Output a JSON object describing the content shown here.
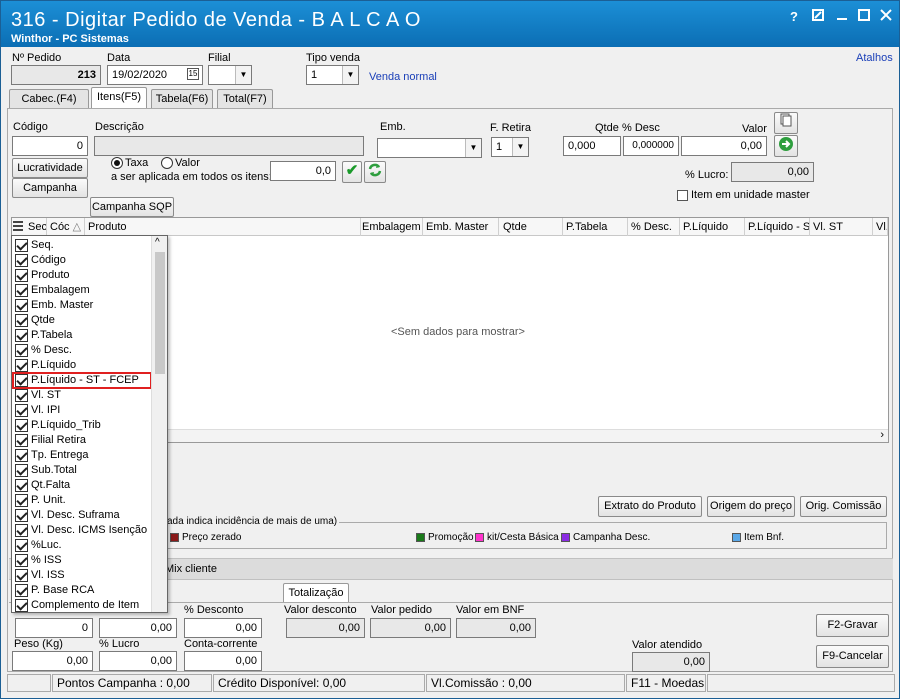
{
  "window": {
    "title": "316 - Digitar Pedido de Venda - B A L C A O",
    "subtitle": "Winthor - PC Sistemas",
    "help_label": "?",
    "atalhos": "Atalhos"
  },
  "header": {
    "pedido_label": "Nº Pedido",
    "pedido_value": "213",
    "data_label": "Data",
    "data_value": "19/02/2020",
    "filial_label": "Filial",
    "filial_value": "",
    "tipo_venda_label": "Tipo venda",
    "tipo_venda_value": "1",
    "venda_normal": "Venda normal"
  },
  "tabs": [
    {
      "label": "Cabec.(F4)"
    },
    {
      "label": "Itens(F5)"
    },
    {
      "label": "Tabela(F6)"
    },
    {
      "label": "Total(F7)"
    }
  ],
  "item_form": {
    "codigo_label": "Código",
    "codigo_value": "0",
    "descricao_label": "Descrição",
    "emb_label": "Emb.",
    "f_retira_label": "F. Retira",
    "f_retira_value": "1",
    "qtde_label": "Qtde",
    "qtde_value": "0,000",
    "pct_desc_label": "% Desc",
    "pct_desc_value": "0,000000",
    "valor_label": "Valor",
    "valor_value": "0,00",
    "lucratividade": "Lucratividade",
    "campanha": "Campanha",
    "taxa_label": "Taxa",
    "valor_radio_label": "Valor",
    "aplicada_label": "a ser aplicada em todos os itens:",
    "aplicada_value": "0,0",
    "pct_lucro_label": "% Lucro:",
    "pct_lucro_value": "0,00",
    "item_master_label": "Item em unidade master",
    "campanha_sqp": "Campanha SQP"
  },
  "grid": {
    "columns": [
      "Sec",
      "Cóc",
      "Produto",
      "Embalagem",
      "Emb. Master",
      "Qtde",
      "P.Tabela",
      "% Desc.",
      "P.Líquido",
      "P.Líquido - S",
      "Vl. ST",
      "Vl."
    ],
    "empty_text": "<Sem dados para mostrar>"
  },
  "column_menu": {
    "items": [
      "Seq.",
      "Código",
      "Produto",
      "Embalagem",
      "Emb. Master",
      "Qtde",
      "P.Tabela",
      "% Desc.",
      "P.Líquido",
      "P.Líquido -  ST - FCEP",
      "Vl. ST",
      "Vl. IPI",
      "P.Líquido_Trib",
      "Filial Retira",
      "Tp. Entrega",
      "Sub.Total",
      "Qt.Falta",
      "P. Unit.",
      "Vl. Desc. Suframa",
      "Vl. Desc. ICMS Isenção",
      "%Luc.",
      "% ISS",
      "Vl. ISS",
      "P. Base RCA",
      "Complemento de Item"
    ],
    "highlighted_index": 9
  },
  "actions": {
    "extrato": "Extrato do Produto",
    "origem": "Origem do preço",
    "comissao": "Orig. Comissão"
  },
  "legend": {
    "caption": "ada indica incidência de mais de uma)",
    "items": [
      {
        "label": "Preço zerado",
        "color": "#8b1a1a"
      },
      {
        "label": "Promoção",
        "color": "#1a7a1a"
      },
      {
        "label": "kit/Cesta Básica",
        "color": "#ff33cc"
      },
      {
        "label": "Campanha Desc.",
        "color": "#8a2be2"
      },
      {
        "label": "Item Bnf.",
        "color": "#5aa8e8"
      }
    ]
  },
  "mix_cliente": "Mix cliente",
  "totalizacao": {
    "tab_label": "Totalização",
    "left_value_1": "0",
    "left_value_2": "0,00",
    "pct_desconto_label": "% Desconto",
    "pct_desconto_value": "0,00",
    "valor_desconto_label": "Valor desconto",
    "valor_desconto_value": "0,00",
    "valor_pedido_label": "Valor pedido",
    "valor_pedido_value": "0,00",
    "valor_bnf_label": "Valor em BNF",
    "valor_bnf_value": "0,00",
    "peso_label": "Peso (Kg)",
    "peso_value": "0,00",
    "pct_lucro_label": "% Lucro",
    "pct_lucro_value": "0,00",
    "conta_label": "Conta-corrente",
    "conta_value": "0,00",
    "valor_atendido_label": "Valor atendido",
    "valor_atendido_value": "0,00",
    "gravar": "F2-Gravar",
    "cancelar": "F9-Cancelar"
  },
  "status": {
    "pontos": "Pontos Campanha : 0,00",
    "credito": "Crédito Disponível: 0,00",
    "comissao": "Vl.Comissão : 0,00",
    "moedas": "F11 - Moedas"
  }
}
